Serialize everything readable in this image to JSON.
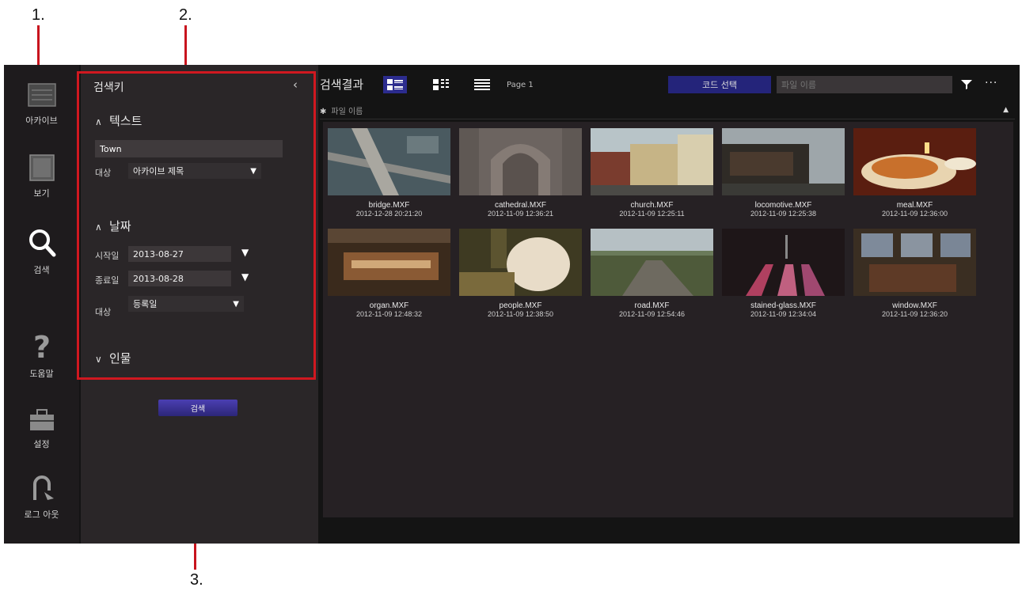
{
  "callouts": [
    "1.",
    "2.",
    "3."
  ],
  "rail": {
    "items": [
      {
        "label": "아카이브",
        "icon": "archive-icon"
      },
      {
        "label": "보기",
        "icon": "view-icon"
      },
      {
        "label": "검색",
        "icon": "search-icon"
      },
      {
        "label": "도움말",
        "icon": "help-icon"
      },
      {
        "label": "설정",
        "icon": "toolbox-icon"
      },
      {
        "label": "로그 아웃",
        "icon": "logout-icon"
      }
    ]
  },
  "search_panel": {
    "title": "검색키",
    "collapse_glyph": "‹",
    "text_section": {
      "heading": "텍스트",
      "input_value": "Town",
      "target_label": "대상",
      "target_value": "아카이브 제목"
    },
    "date_section": {
      "heading": "날짜",
      "start_label": "시작일",
      "start_value": "2013-08-27",
      "end_label": "종료일",
      "end_value": "2013-08-28",
      "target_label": "대상",
      "target_value": "등록일"
    },
    "person_section": {
      "heading": "인물"
    },
    "search_button": "검색"
  },
  "results": {
    "title": "검색결과",
    "page_label": "Page 1",
    "code_button": "코드 선택",
    "filter_placeholder": "파일 이름",
    "sort_label": "파일 이름",
    "items": [
      {
        "name": "bridge.MXF",
        "date": "2012-12-28 20:21:20"
      },
      {
        "name": "cathedral.MXF",
        "date": "2012-11-09 12:36:21"
      },
      {
        "name": "church.MXF",
        "date": "2012-11-09 12:25:11"
      },
      {
        "name": "locomotive.MXF",
        "date": "2012-11-09 12:25:38"
      },
      {
        "name": "meal.MXF",
        "date": "2012-11-09 12:36:00"
      },
      {
        "name": "organ.MXF",
        "date": "2012-11-09 12:48:32"
      },
      {
        "name": "people.MXF",
        "date": "2012-11-09 12:38:50"
      },
      {
        "name": "road.MXF",
        "date": "2012-11-09 12:54:46"
      },
      {
        "name": "stained-glass.MXF",
        "date": "2012-11-09 12:34:04"
      },
      {
        "name": "window.MXF",
        "date": "2012-11-09 12:36:20"
      }
    ]
  },
  "colors": {
    "accent": "#2c2c8e",
    "callout_red": "#c8141e",
    "background": "#141414"
  }
}
